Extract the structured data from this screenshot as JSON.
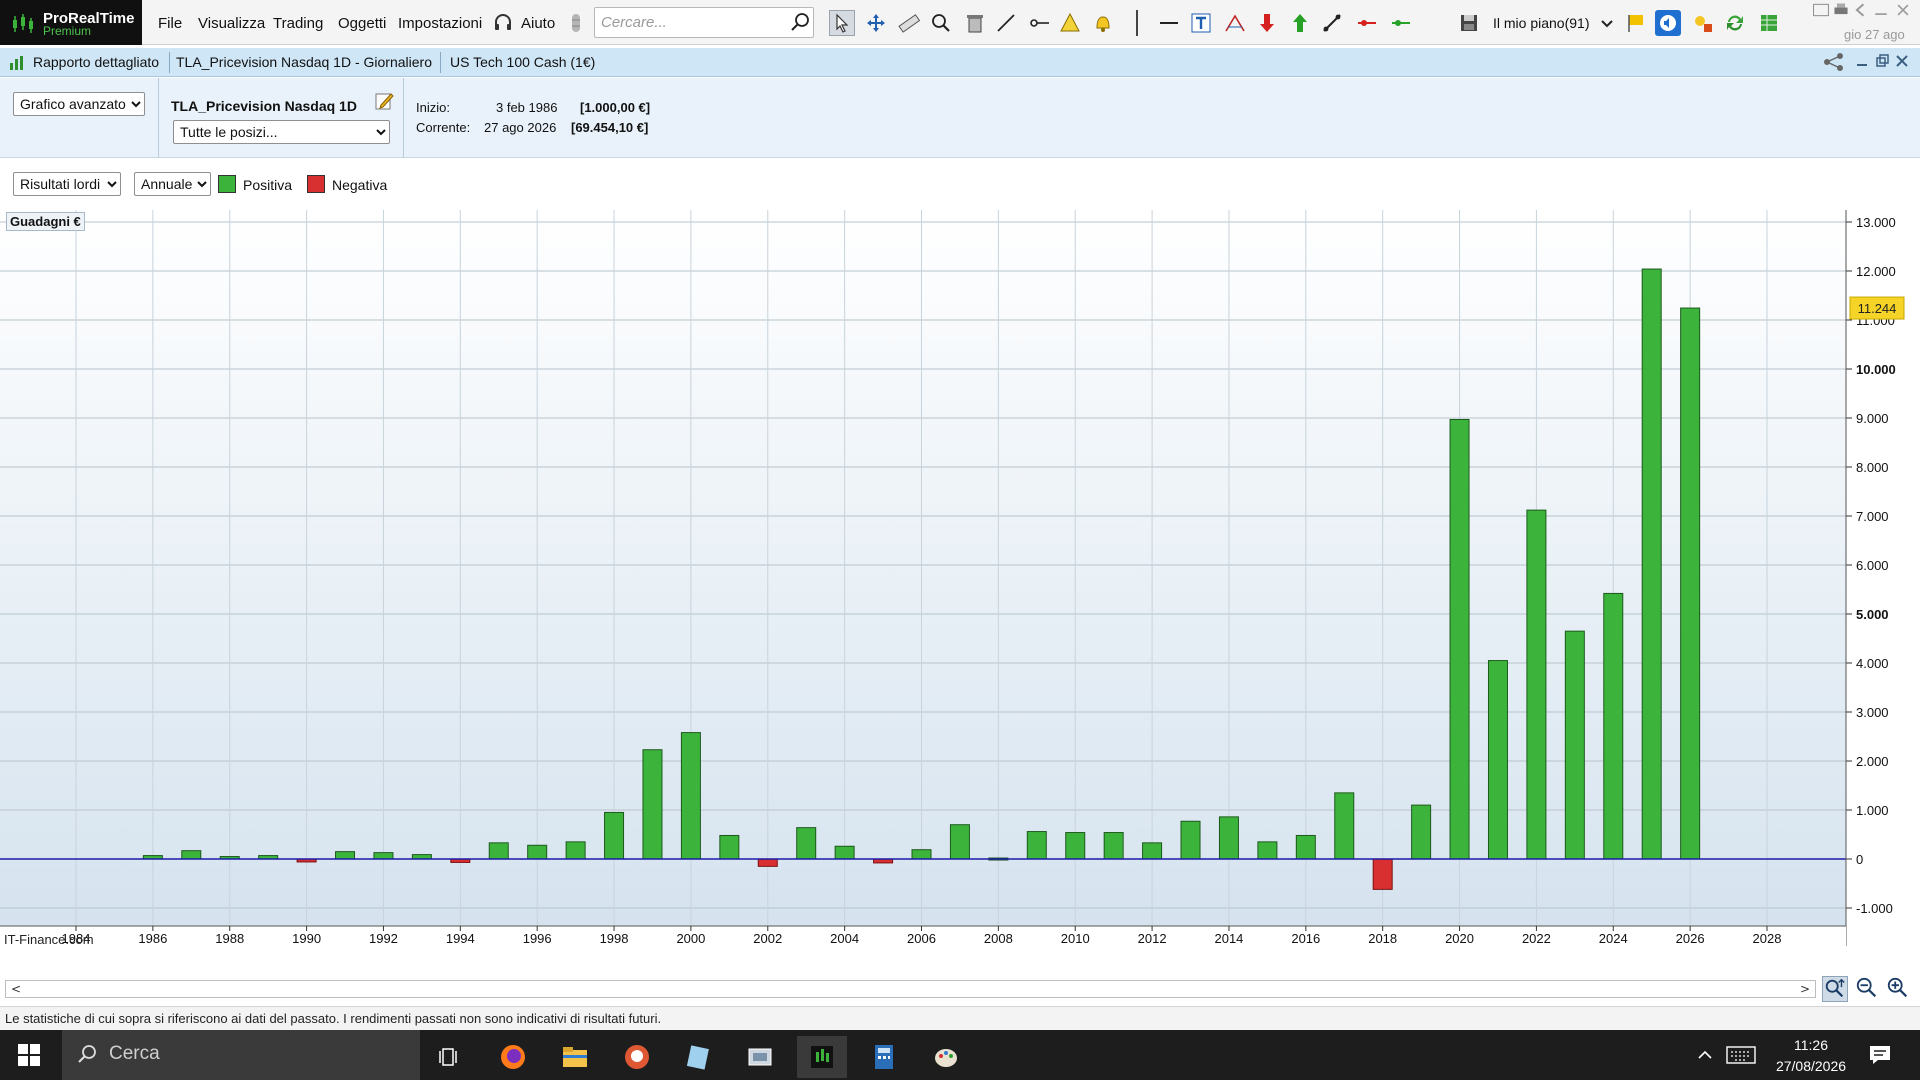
{
  "app": {
    "name": "ProRealTime",
    "edition": "Premium"
  },
  "menu": [
    "File",
    "Visualizza",
    "Trading",
    "Oggetti",
    "Impostazioni"
  ],
  "help_label": "Aiuto",
  "search": {
    "placeholder": "Cercare..."
  },
  "plan": {
    "label": "Il mio piano(91)"
  },
  "date_top": "gio 27 ago",
  "tabs": [
    "Rapporto dettagliato",
    "TLA_Pricevision Nasdaq 1D - Giornaliero",
    "US Tech 100 Cash (1€)"
  ],
  "info": {
    "view_select": "Grafico avanzato",
    "system_name": "TLA_Pricevision Nasdaq 1D",
    "positions_select": "Tutte le posizi...",
    "start_label": "Inizio:",
    "start_date": "3 feb 1986",
    "start_value": "[1.000,00 €]",
    "current_label": "Corrente:",
    "current_date": "27 ago 2026",
    "current_value": "[69.454,10 €]"
  },
  "options": {
    "results_select": "Risultati lordi",
    "period_select": "Annuale",
    "legend_positive": "Positiva",
    "legend_negative": "Negativa",
    "positive_color": "#3cb43c",
    "negative_color": "#d83030"
  },
  "footnote": "Le statistiche di cui sopra si riferiscono ai dati del passato. I rendimenti passati non sono indicativi di risultati futuri.",
  "taskbar": {
    "search_label": "Cerca",
    "time": "11:26",
    "date": "27/08/2026"
  },
  "chart_data": {
    "type": "bar",
    "ylabel": "Guadagni €",
    "watermark": "IT-Finance.com",
    "ylim": [
      -1000,
      13000
    ],
    "y_ticks": [
      -1000,
      0,
      1000,
      2000,
      3000,
      4000,
      5000,
      6000,
      7000,
      8000,
      9000,
      10000,
      11000,
      12000,
      13000
    ],
    "y_tick_labels": [
      "-1.000",
      "0",
      "1.000",
      "2.000",
      "3.000",
      "4.000",
      "5.000",
      "6.000",
      "7.000",
      "8.000",
      "9.000",
      "10.000",
      "11.000",
      "12.000",
      "13.000"
    ],
    "x_ticks": [
      1984,
      1986,
      1988,
      1990,
      1992,
      1994,
      1996,
      1998,
      2000,
      2002,
      2004,
      2006,
      2008,
      2010,
      2012,
      2014,
      2016,
      2018,
      2020,
      2022,
      2024,
      2026,
      2028
    ],
    "xlim": [
      1982,
      2030
    ],
    "grid": true,
    "last_value_label": "11.244",
    "series": [
      {
        "x": [
          1986,
          1987,
          1988,
          1989,
          1990,
          1991,
          1992,
          1993,
          1994,
          1995,
          1996,
          1997,
          1998,
          1999,
          2000,
          2001,
          2002,
          2003,
          2004,
          2005,
          2006,
          2007,
          2008,
          2009,
          2010,
          2011,
          2012,
          2013,
          2014,
          2015,
          2016,
          2017,
          2018,
          2019,
          2020,
          2021,
          2022,
          2023,
          2024,
          2025,
          2026
        ],
        "values": [
          70,
          170,
          50,
          70,
          -60,
          150,
          130,
          90,
          -70,
          330,
          280,
          350,
          950,
          2230,
          2580,
          480,
          -150,
          640,
          260,
          -80,
          190,
          700,
          20,
          560,
          540,
          540,
          330,
          770,
          860,
          350,
          480,
          1350,
          -620,
          1100,
          8970,
          4050,
          7120,
          4650,
          5420,
          12040,
          11244
        ]
      }
    ]
  }
}
